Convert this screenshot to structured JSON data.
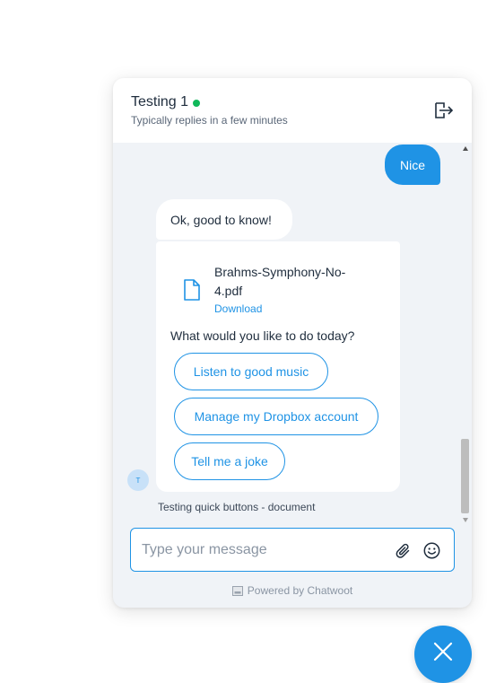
{
  "header": {
    "title": "Testing 1",
    "subtitle": "Typically replies in a few minutes",
    "online_color": "#10b85a",
    "exit_icon": "exit-icon"
  },
  "messages": {
    "user_message": "Nice",
    "bot_message": "Ok, good to know!",
    "attachment": {
      "file_name": "Brahms-Symphony-No-4.pdf",
      "download_label": "Download",
      "icon": "file-icon"
    },
    "question": "What would you like to do today?",
    "quick_buttons": [
      {
        "label": "Listen to good music"
      },
      {
        "label": "Manage my Dropbox account"
      },
      {
        "label": "Tell me a joke"
      }
    ],
    "avatar_initial": "T",
    "caption": "Testing quick buttons - document"
  },
  "composer": {
    "placeholder": "Type your message",
    "value": ""
  },
  "footer": {
    "powered_by": "Powered by Chatwoot"
  },
  "colors": {
    "accent": "#1f93e5",
    "background": "#f0f3f7"
  }
}
